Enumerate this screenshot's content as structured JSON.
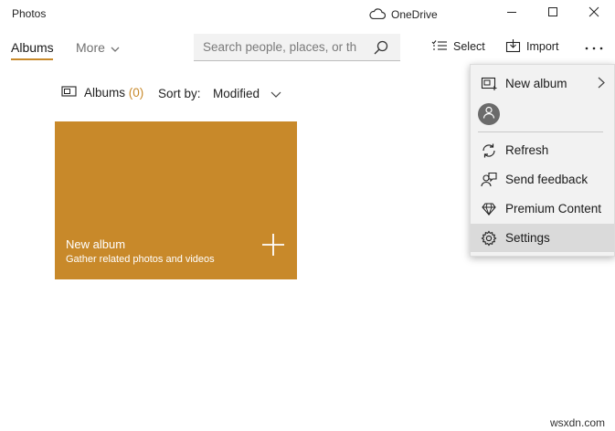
{
  "window": {
    "title": "Photos",
    "onedrive_label": "OneDrive"
  },
  "nav": {
    "tabs": [
      {
        "label": "Albums",
        "active": true
      },
      {
        "label": "More",
        "active": false
      }
    ],
    "search_placeholder": "Search people, places, or th",
    "select_label": "Select",
    "import_label": "Import"
  },
  "albums_header": {
    "label": "Albums",
    "count": "(0)",
    "sort_label": "Sort by:",
    "sort_value": "Modified"
  },
  "tile": {
    "title": "New album",
    "subtitle": "Gather related photos and videos",
    "color": "#c8892a"
  },
  "menu": {
    "items": [
      {
        "label": "New album",
        "icon": "new-album-icon",
        "has_submenu": true
      },
      {
        "label": "",
        "icon": "person-icon"
      },
      {
        "label": "Refresh",
        "icon": "refresh-icon"
      },
      {
        "label": "Send feedback",
        "icon": "feedback-icon"
      },
      {
        "label": "Premium Content",
        "icon": "diamond-icon"
      },
      {
        "label": "Settings",
        "icon": "gear-icon",
        "highlighted": true
      }
    ]
  },
  "watermark": "wsxdn.com",
  "colors": {
    "accent": "#c8892a",
    "menu_bg": "#f2f2f2",
    "menu_highlight": "#dadada"
  }
}
